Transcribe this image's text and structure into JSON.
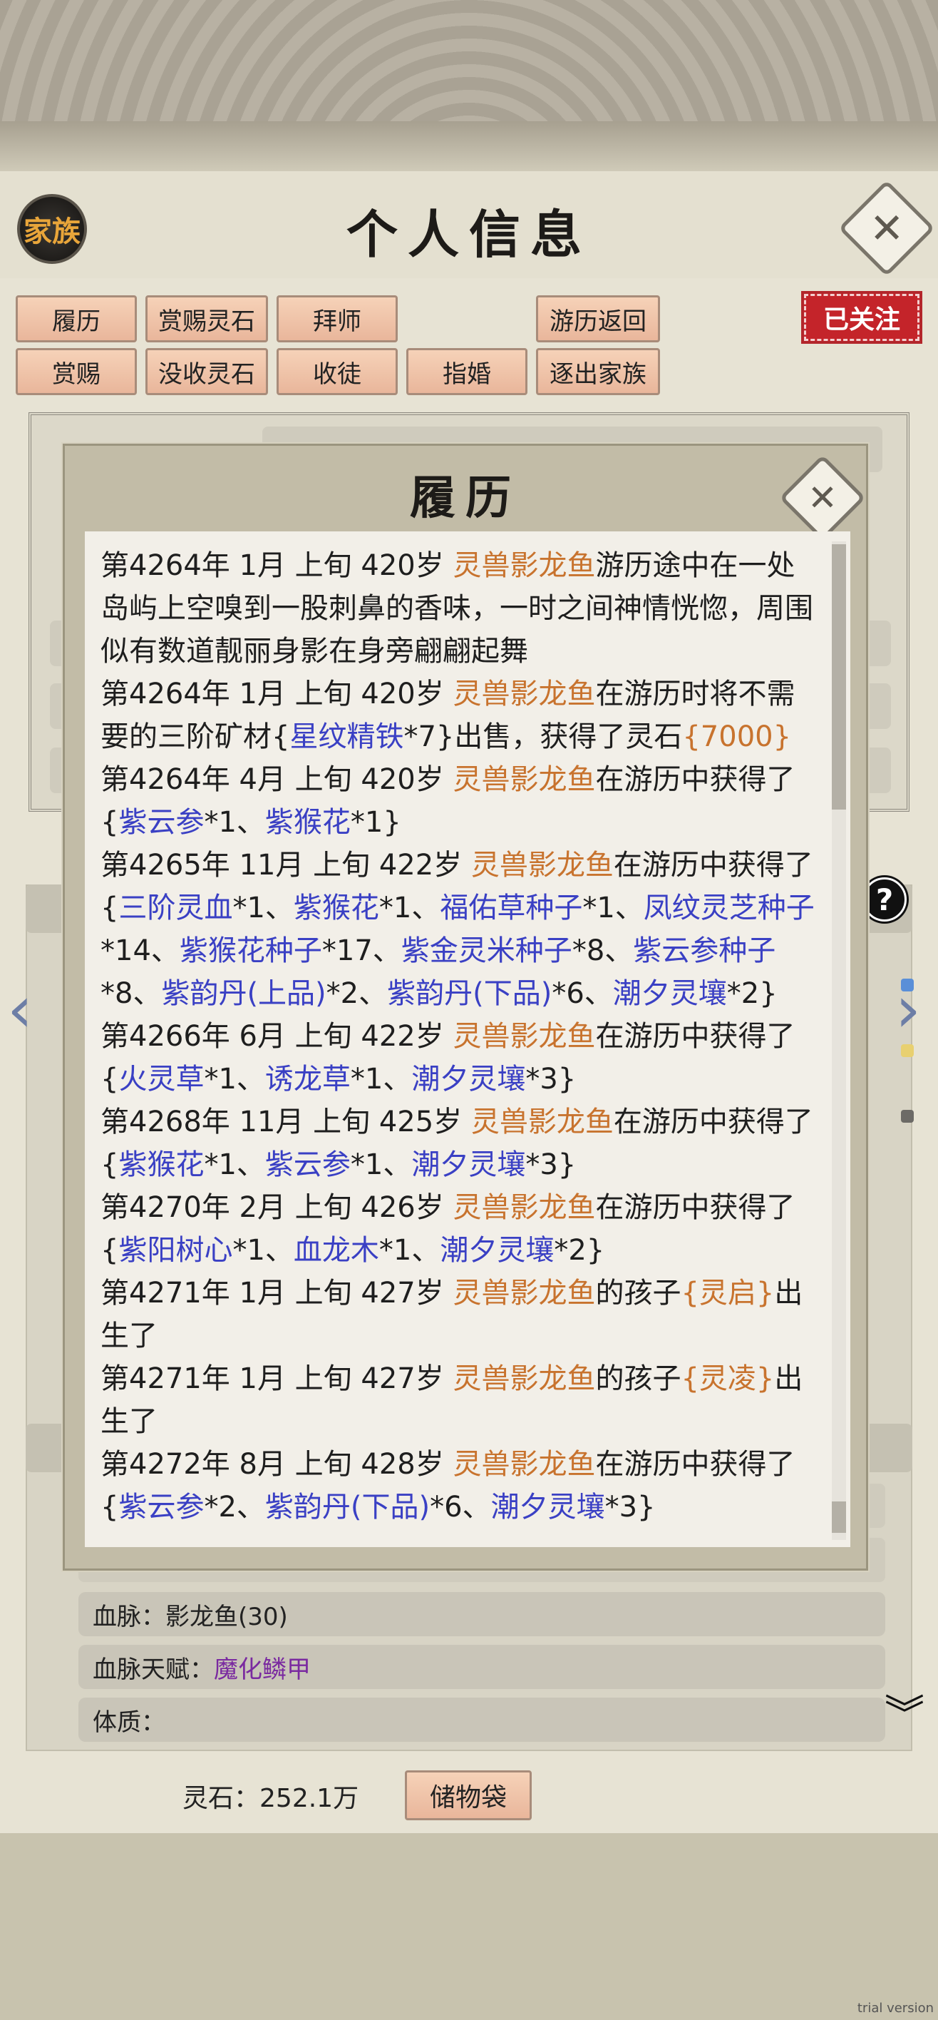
{
  "header": {
    "clan_badge": "家族",
    "title": "个人信息"
  },
  "actions": {
    "row1": [
      "履历",
      "赏赐灵石",
      "拜师",
      "游历返回"
    ],
    "row2": [
      "赏赐",
      "没收灵石",
      "收徒",
      "指婚",
      "逐出家族"
    ],
    "followed": "已关注"
  },
  "info": {
    "bloodline_label": "血脉：",
    "bloodline_value": "影龙鱼(30)",
    "bloodline_talent_label": "血脉天赋：",
    "bloodline_talent_value": "魔化鳞甲",
    "constitution_label": "体质："
  },
  "footer": {
    "stones_label": "灵石：",
    "stones_value": "252.1万",
    "storage_button": "储物袋"
  },
  "modal": {
    "title": "履历",
    "entries": [
      {
        "p1": "第4264年 1月 上旬 420岁 ",
        "name": "灵兽影龙鱼",
        "p2": "游历途中在一处岛屿上空嗅到一股刺鼻的香味，一时之间神情恍惚，周围似有数道靓丽身影在身旁翩翩起舞"
      },
      {
        "p1": "第4264年 1月 上旬 420岁 ",
        "name": "灵兽影龙鱼",
        "p2": "在游历时将不需要的三阶矿材{",
        "item": "星纹精铁",
        "p3": "*7}出售，获得了灵石",
        "amount": "{7000}"
      },
      {
        "p1": "第4264年 4月 上旬 420岁 ",
        "name": "灵兽影龙鱼",
        "p2": "在游历中获得了{",
        "items": [
          "紫云参",
          "*1、",
          "紫猴花",
          "*1}"
        ]
      },
      {
        "p1": "第4265年 11月 上旬  422岁  ",
        "name": "灵兽影龙鱼",
        "p2": "在游历中获得了{",
        "items": [
          "三阶灵血",
          "*1、",
          "紫猴花",
          "*1、",
          "福佑草种子",
          "*1、",
          "凤纹灵芝种子",
          "*14、",
          "紫猴花种子",
          "*17、",
          "紫金灵米种子",
          "*8、",
          "紫云参种子",
          "*8、",
          "紫韵丹(上品)",
          "*2、",
          "紫韵丹(下品)",
          "*6、",
          "潮夕灵壤",
          "*2}"
        ]
      },
      {
        "p1": "第4266年 6月 上旬  422岁  ",
        "name": "灵兽影龙鱼",
        "p2": "在游历中获得了{",
        "items": [
          "火灵草",
          "*1、",
          "诱龙草",
          "*1、",
          "潮夕灵壤",
          "*3}"
        ]
      },
      {
        "p1": "第4268年 11月 上旬  425岁  ",
        "name": "灵兽影龙鱼",
        "p2": "在游历中获得了{",
        "items": [
          "紫猴花",
          "*1、",
          "紫云参",
          "*1、",
          "潮夕灵壤",
          "*3}"
        ]
      },
      {
        "p1": "第4270年 2月 上旬  426岁  ",
        "name": "灵兽影龙鱼",
        "p2": "在游历中获得了{",
        "items": [
          "紫阳树心",
          "*1、",
          "血龙木",
          "*1、",
          "潮夕灵壤",
          "*2}"
        ]
      },
      {
        "p1": "第4271年 1月 上旬  427岁  ",
        "name": "灵兽影龙鱼",
        "p2": "的孩子",
        "child": "{灵启}",
        "p3": "出生了"
      },
      {
        "p1": "第4271年 1月 上旬  427岁  ",
        "name": "灵兽影龙鱼",
        "p2": "的孩子",
        "child": "{灵凌}",
        "p3": "出生了"
      },
      {
        "p1": "第4272年 8月 上旬  428岁  ",
        "name": "灵兽影龙鱼",
        "p2": "在游历中获得了{",
        "items": [
          "紫云参",
          "*2、",
          "紫韵丹(下品)",
          "*6、",
          "潮夕灵壤",
          "*3}"
        ]
      }
    ]
  },
  "watermark": "trial version",
  "colors": {
    "pet_name": "#c8732e",
    "item": "#3a40c4",
    "followed_bg": "#c4242a",
    "button_bg": "#efc2a6"
  }
}
